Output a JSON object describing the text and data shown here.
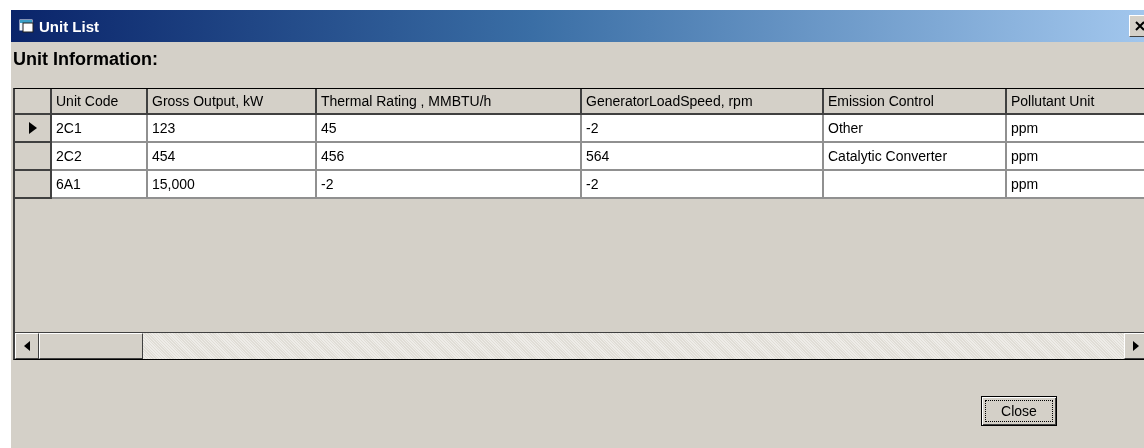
{
  "window": {
    "title": "Unit List"
  },
  "section_title": "Unit Information:",
  "table": {
    "columns": [
      "Unit Code",
      "Gross Output, kW",
      "Thermal Rating , MMBTU/h",
      "GeneratorLoadSpeed, rpm",
      "Emission Control",
      "Pollutant Unit"
    ],
    "rows": [
      {
        "selected": true,
        "cells": [
          "2C1",
          "123",
          "45",
          "-2",
          "Other",
          "ppm"
        ]
      },
      {
        "selected": false,
        "cells": [
          "2C2",
          "454",
          "456",
          "564",
          "Catalytic Converter",
          "ppm"
        ]
      },
      {
        "selected": false,
        "cells": [
          "6A1",
          "15,000",
          "-2",
          "-2",
          "",
          "ppm"
        ]
      }
    ]
  },
  "buttons": [
    "Close"
  ]
}
